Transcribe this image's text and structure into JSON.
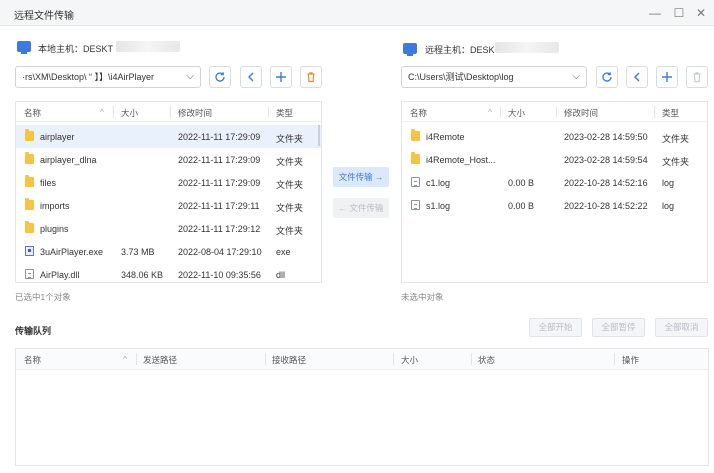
{
  "window": {
    "title": "远程文件传输",
    "controls": {
      "minimize": "—",
      "maximize": "☐",
      "close": "✕"
    }
  },
  "local": {
    "host_label": "本地主机：DESKT",
    "path": "·rs\\XM\\Desktop\\  “  】】\\i4AirPlayer",
    "columns": [
      "名称",
      "大小",
      "修改时间",
      "类型"
    ],
    "files": [
      {
        "name": "airplayer",
        "size": "",
        "modified": "2022-11-11 17:29:09",
        "type": "文件夹",
        "icon": "folder-icon"
      },
      {
        "name": "airplayer_dlna",
        "size": "",
        "modified": "2022-11-11 17:29:09",
        "type": "文件夹",
        "icon": "folder-icon"
      },
      {
        "name": "files",
        "size": "",
        "modified": "2022-11-11 17:29:09",
        "type": "文件夹",
        "icon": "folder-icon"
      },
      {
        "name": "imports",
        "size": "",
        "modified": "2022-11-11 17:29:11",
        "type": "文件夹",
        "icon": "folder-icon"
      },
      {
        "name": "plugins",
        "size": "",
        "modified": "2022-11-11 17:29:12",
        "type": "文件夹",
        "icon": "folder-icon"
      },
      {
        "name": "3uAirPlayer.exe",
        "size": "3.73 MB",
        "modified": "2022-08-04 17:29:10",
        "type": "exe",
        "icon": "exe-icon"
      },
      {
        "name": "AirPlay.dll",
        "size": "348.06 KB",
        "modified": "2022-11-10 09:35:56",
        "type": "dll",
        "icon": "file-icon"
      }
    ],
    "status": "已选中1个对象"
  },
  "remote": {
    "host_label": "远程主机：DESK",
    "path": "C:\\Users\\测试\\Desktop\\log",
    "columns": [
      "名称",
      "大小",
      "修改时间",
      "类型"
    ],
    "files": [
      {
        "name": "i4Remote",
        "size": "",
        "modified": "2023-02-28 14:59:50",
        "type": "文件夹",
        "icon": "folder-icon"
      },
      {
        "name": "i4Remote_Host...",
        "size": "",
        "modified": "2023-02-28 14:59:54",
        "type": "文件夹",
        "icon": "folder-icon"
      },
      {
        "name": "c1.log",
        "size": "0.00 B",
        "modified": "2022-10-28 14:52:16",
        "type": "log",
        "icon": "file-icon"
      },
      {
        "name": "s1.log",
        "size": "0.00 B",
        "modified": "2022-10-28 14:52:22",
        "type": "log",
        "icon": "file-icon"
      }
    ],
    "status": "未选中对象"
  },
  "transfer": {
    "send_label": "文件传输 →",
    "receive_label": "← 文件传输"
  },
  "queue": {
    "title": "传输队列",
    "buttons": {
      "start_all": "全部开始",
      "pause_all": "全部暂停",
      "cancel_all": "全部取消"
    },
    "columns": [
      "名称",
      "发送路径",
      "接收路径",
      "大小",
      "状态",
      "操作"
    ]
  },
  "colors": {
    "accent": "#3b7be0",
    "folder": "#f6c445",
    "delete": "#f08c2b",
    "selected_row": "#e9f1fd"
  }
}
